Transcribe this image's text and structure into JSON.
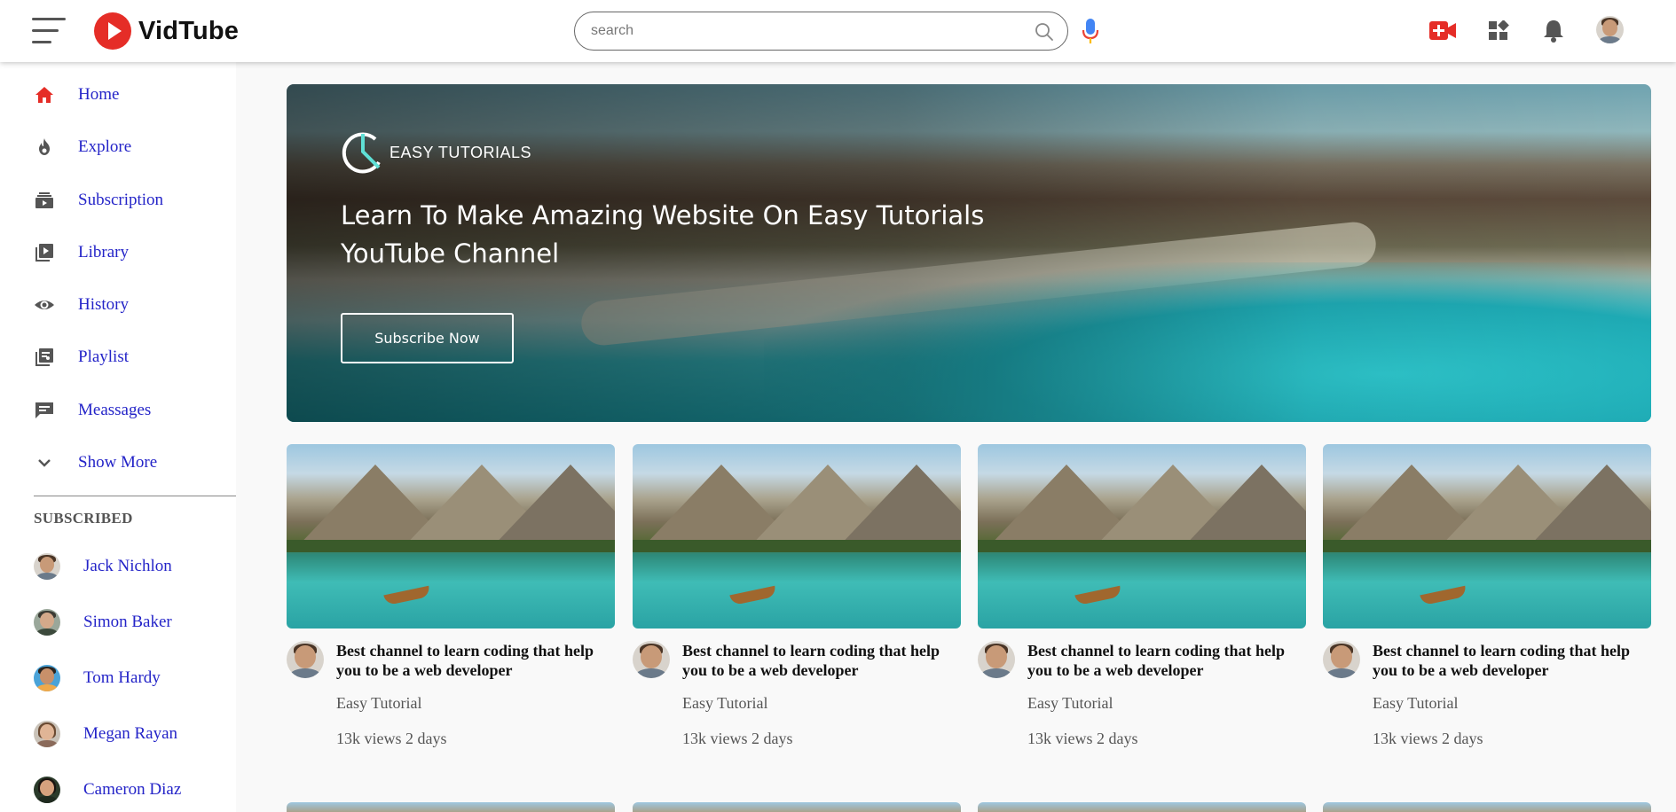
{
  "header": {
    "logo_text": "VidTube",
    "search_placeholder": "search"
  },
  "sidebar": {
    "items": [
      {
        "label": "Home",
        "icon": "home-icon"
      },
      {
        "label": "Explore",
        "icon": "fire-icon"
      },
      {
        "label": "Subscription",
        "icon": "subscription-icon"
      },
      {
        "label": "Library",
        "icon": "library-icon"
      },
      {
        "label": "History",
        "icon": "history-eye-icon"
      },
      {
        "label": "Playlist",
        "icon": "playlist-icon"
      },
      {
        "label": "Meassages",
        "icon": "messages-icon"
      },
      {
        "label": "Show More",
        "icon": "chevron-down-icon"
      }
    ],
    "subscribed_title": "SUBSCRIBED",
    "subscribed": [
      {
        "name": "Jack Nichlon"
      },
      {
        "name": "Simon Baker"
      },
      {
        "name": "Tom Hardy"
      },
      {
        "name": "Megan Rayan"
      },
      {
        "name": "Cameron Diaz"
      }
    ]
  },
  "banner": {
    "logo_text": "EASY TUTORIALS",
    "title": "Learn To Make Amazing Website On Easy Tutorials YouTube Channel",
    "button_label": "Subscribe Now"
  },
  "videos": [
    {
      "title": "Best channel to learn coding that help you to be a web developer",
      "channel": "Easy Tutorial",
      "meta": "13k views 2 days"
    },
    {
      "title": "Best channel to learn coding that help you to be a web developer",
      "channel": "Easy Tutorial",
      "meta": "13k views 2 days"
    },
    {
      "title": "Best channel to learn coding that help you to be a web developer",
      "channel": "Easy Tutorial",
      "meta": "13k views 2 days"
    },
    {
      "title": "Best channel to learn coding that help you to be a web developer",
      "channel": "Easy Tutorial",
      "meta": "13k views 2 days"
    }
  ],
  "colors": {
    "brand_red": "#e52d27",
    "link_blue": "#2424c8",
    "mic_blue": "#4285f4"
  }
}
